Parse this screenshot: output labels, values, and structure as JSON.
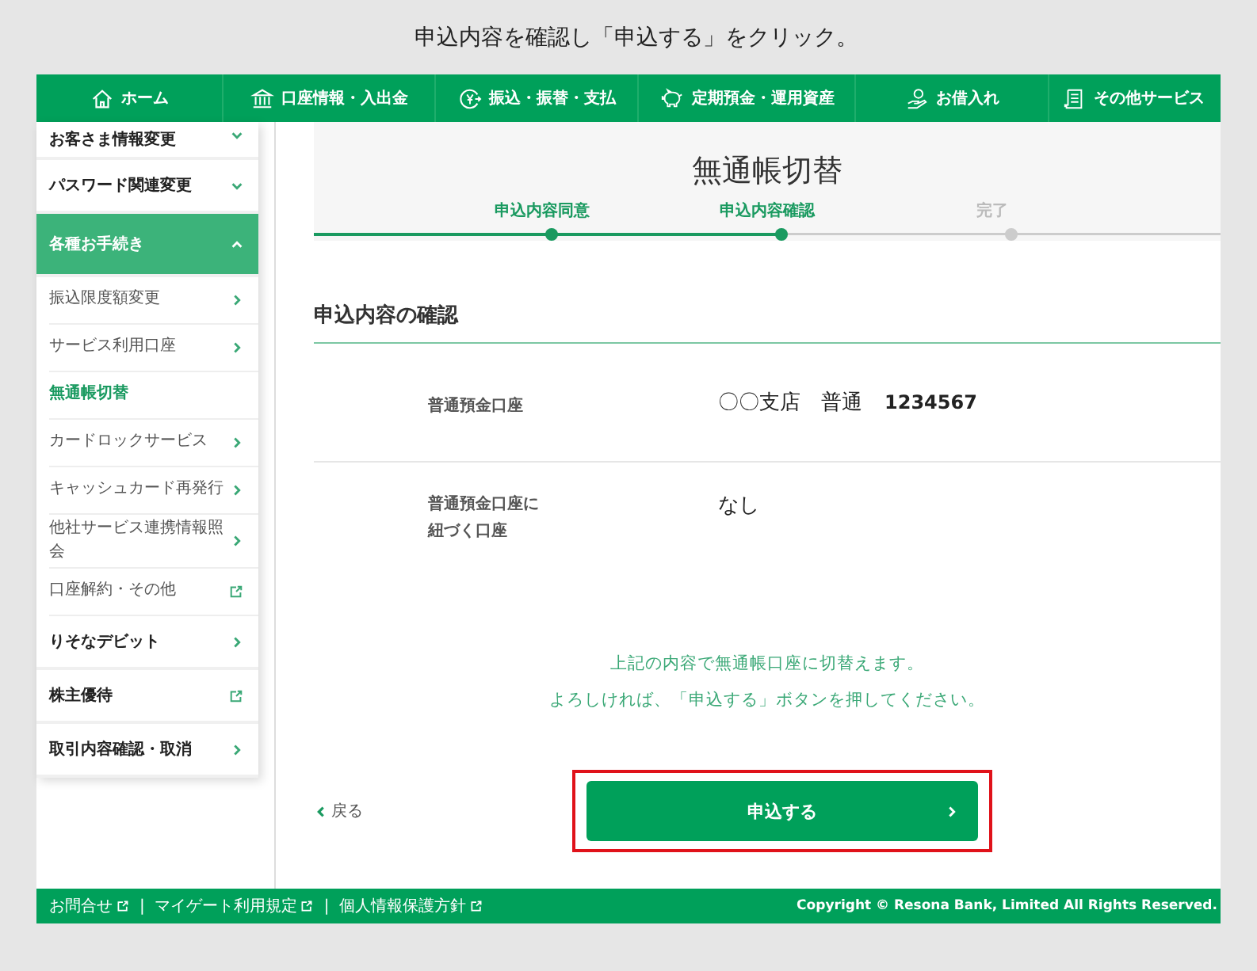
{
  "caption": "申込内容を確認し「申込する」をクリック。",
  "nav": [
    {
      "label": "ホーム"
    },
    {
      "label": "口座情報・入出金"
    },
    {
      "label": "振込・振替・支払"
    },
    {
      "label": "定期預金・運用資産"
    },
    {
      "label": "お借入れ"
    },
    {
      "label": "その他サービス"
    }
  ],
  "sidebar": {
    "items": [
      {
        "label": "お客さま情報変更",
        "kind": "group",
        "expanded": false
      },
      {
        "label": "パスワード関連変更",
        "kind": "group",
        "expanded": false
      },
      {
        "label": "各種お手続き",
        "kind": "group",
        "expanded": true,
        "children": [
          {
            "label": "振込限度額変更",
            "external": false,
            "selected": false
          },
          {
            "label": "サービス利用口座",
            "external": false,
            "selected": false
          },
          {
            "label": "無通帳切替",
            "selected": true
          },
          {
            "label": "カードロックサービス",
            "external": false,
            "selected": false
          },
          {
            "label": "キャッシュカード再発行",
            "external": false,
            "selected": false
          },
          {
            "label": "他社サービス連携情報照会",
            "external": false,
            "selected": false
          },
          {
            "label": "口座解約・その他",
            "external": true,
            "selected": false
          }
        ]
      },
      {
        "label": "りそなデビット",
        "kind": "link",
        "external": false
      },
      {
        "label": "株主優待",
        "kind": "link",
        "external": true
      },
      {
        "label": "取引内容確認・取消",
        "kind": "link",
        "external": false
      }
    ]
  },
  "page_title": "無通帳切替",
  "steps": [
    {
      "label": "申込内容同意",
      "done": true
    },
    {
      "label": "申込内容確認",
      "done": true
    },
    {
      "label": "完了",
      "done": false
    }
  ],
  "section_title": "申込内容の確認",
  "rows": [
    {
      "label": "普通預金口座",
      "value": "〇〇支店　普通",
      "number": "1234567"
    },
    {
      "label": "普通預金口座に紐づく口座",
      "value": "なし"
    }
  ],
  "message": [
    "上記の内容で無通帳口座に切替えます。",
    "よろしければ、「申込する」ボタンを押してください。"
  ],
  "back_link": "戻る",
  "submit_button": {
    "label": "申込する",
    "highlighted": true
  },
  "footer": {
    "links": [
      "お問合せ",
      "マイゲート利用規定",
      "個人情報保護方針"
    ],
    "separator": "|",
    "copyright": "Copyright © Resona Bank, Limited All Rights Reserved."
  }
}
